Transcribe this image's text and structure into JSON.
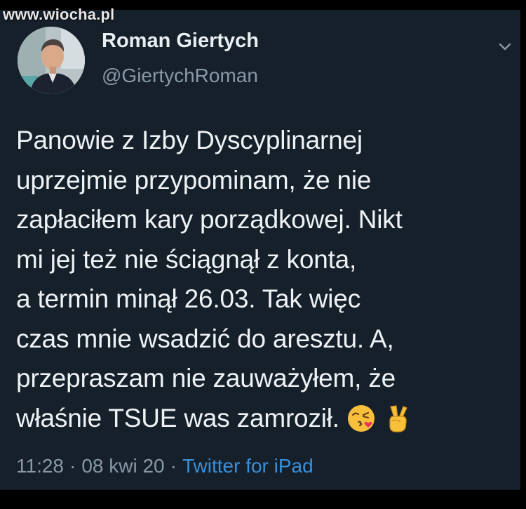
{
  "watermark": "www.wiocha.pl",
  "author": {
    "name": "Roman Giertych",
    "handle": "@GiertychRoman"
  },
  "tweet": {
    "lines": [
      "Panowie z Izby Dyscyplinarnej",
      "uprzejmie przypominam, że nie",
      "zapłaciłem kary porządkowej. Nikt",
      "mi jej też nie ściągnął z konta,",
      "a termin minął 26.03. Tak więc",
      "czas mnie wsadzić do aresztu. A,",
      "przepraszam nie zauważyłem, że",
      "właśnie TSUE was zamroził."
    ],
    "emojis": [
      "kissing-face-with-heart-emoji",
      "victory-hand-emoji"
    ]
  },
  "meta": {
    "time": "11:28",
    "separator": "·",
    "date": "08 kwi 20",
    "source": "Twitter for iPad"
  },
  "icons": {
    "menu": "chevron-down-icon"
  },
  "colors": {
    "background": "#15202b",
    "text": "#eef2f5",
    "secondary": "#8899a6",
    "link": "#3a8fd9"
  }
}
